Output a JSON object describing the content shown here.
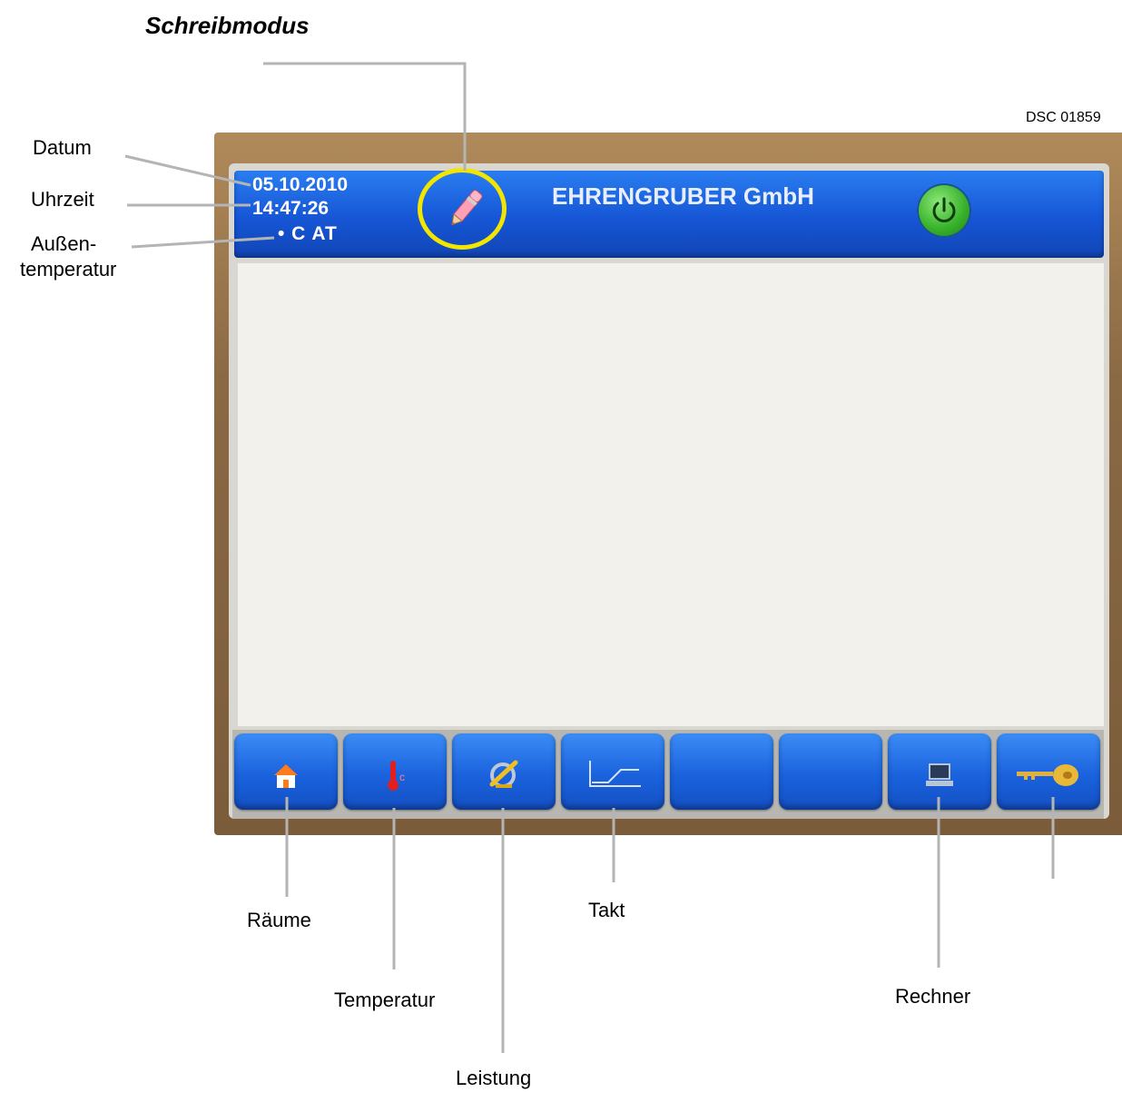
{
  "title": "Schreibmodus",
  "photo_id": "DSC 01859",
  "header": {
    "date": "05.10.2010",
    "time": "14:47:26",
    "outside_temp_unit": "• C AT",
    "brand": "EHRENGRUBER GmbH"
  },
  "annotations": {
    "date": "Datum",
    "time": "Uhrzeit",
    "outside_temp_line1": "Außen-",
    "outside_temp_line2": "temperatur",
    "rooms": "Räume",
    "temperature": "Temperatur",
    "power": "Leistung",
    "cycle": "Takt",
    "computer": "Rechner"
  },
  "nav_buttons": [
    {
      "icon": "house-icon"
    },
    {
      "icon": "thermometer-icon"
    },
    {
      "icon": "power-gauge-icon"
    },
    {
      "icon": "cycle-graph-icon"
    },
    {
      "icon": "blank"
    },
    {
      "icon": "blank"
    },
    {
      "icon": "computer-icon"
    },
    {
      "icon": "key-icon"
    }
  ],
  "colors": {
    "header_blue": "#1656d6",
    "highlight_ring": "#f2e600",
    "power_green": "#38b22a",
    "frame_brown": "#8a6a45"
  }
}
